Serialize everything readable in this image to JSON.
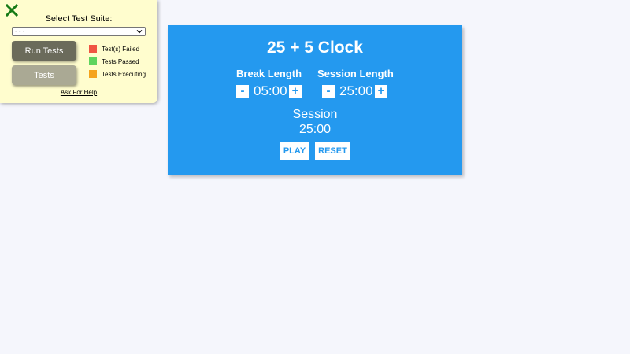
{
  "test_panel": {
    "close_icon": "close-x-icon",
    "suite_label": "Select Test Suite:",
    "suite_selected": "- - -",
    "run_tests_label": "Run Tests",
    "tests_label": "Tests",
    "legend": [
      {
        "label": "Test(s) Failed",
        "color": "#f05542"
      },
      {
        "label": "Tests Passed",
        "color": "#5ed45e"
      },
      {
        "label": "Tests Executing",
        "color": "#f5a31c"
      }
    ],
    "help_label": "Ask For Help",
    "colors": {
      "background": "#fffdce",
      "close": "#167a16"
    }
  },
  "clock": {
    "title": "25 + 5 Clock",
    "break_label": "Break Length",
    "session_label": "Session Length",
    "break_value": "05:00",
    "session_value": "25:00",
    "decrement_label": "-",
    "increment_label": "+",
    "timer_label": "Session",
    "timer_value": "25:00",
    "play_label": "PLAY",
    "reset_label": "RESET",
    "colors": {
      "card": "#2499ef",
      "page": "#f5f6fc"
    }
  }
}
